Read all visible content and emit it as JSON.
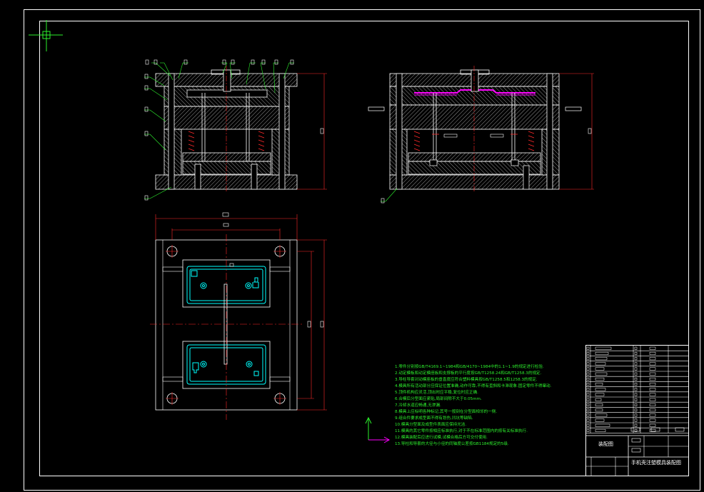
{
  "drawing": {
    "notes": [
      "1.零件分别按GB/T4169.1~1984和GB/4170~1984中的1.1~1.9的规定进行检验.",
      "2.动定模板和动定模座板和支撑板的平行度按GB/T1258.24和GB/T1258.3的规定.",
      "3.导柱导套对动模座板的垂直度应符合塑料模具按GB/T1258.5和1258.3的规定.",
      "4.模具所有活动部分应保证位置准确,动作可靠,不得有歪斜和卡滞现象.固定零件不得窜动.",
      "5.顶件机构应灵活,顶出时应平稳,复位时应正确.",
      "6.合模后分型面应紧贴,局部间隙不大于0.05mm.",
      "7.冷却水道应畅通,无渗漏.",
      "8.模具上应标明各种标记,其号一般刻在分型面相邻的一侧.",
      "9.组合件要求成型面不得有划伤,凹坑等缺陷.",
      "10.模具分型面及成型件表面应保持光洁.",
      "11.模具的其它零件按相应标准执行,对于不在标准范围内的按有关标准执行.",
      "12.模具装配后应进行试模,试模合格后方可交付使用.",
      "13.导柱和导套的大径与小径的同轴度公差按GB1184规定的5级."
    ],
    "title_block": {
      "label_assembly": "装配图",
      "drawing_title": "手机壳注塑模具装配图"
    },
    "colors": {
      "frame": "#ffffff",
      "hatch": "#ffffff",
      "dimension": "#ff2a2a",
      "label_leader": "#2df02d",
      "part_outline": "#00ffff",
      "cavity": "#ff00ff",
      "notes": "#2df02d",
      "axis_y": "#2df02d",
      "axis_x": "#ff00ff",
      "center_line": "#ff2a2a"
    },
    "icons": [
      "crosshair-cursor-icon",
      "ucs-axis-icon"
    ]
  }
}
